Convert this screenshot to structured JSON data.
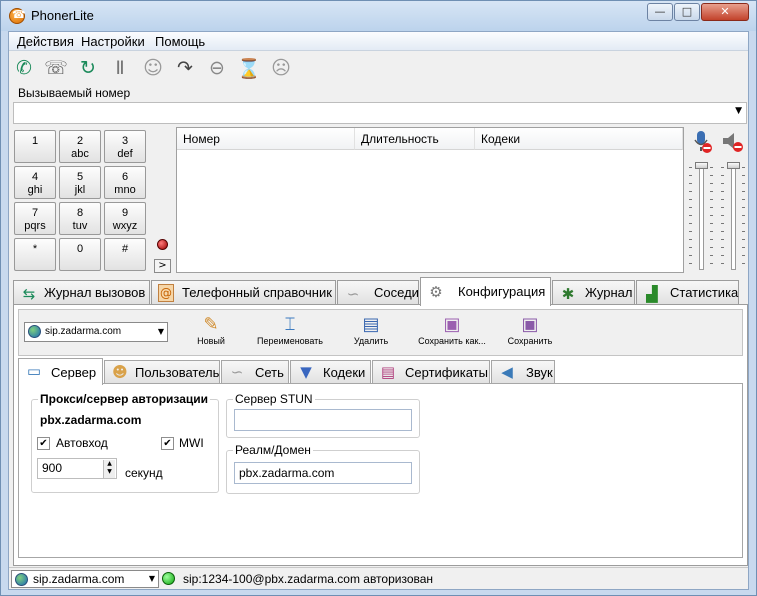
{
  "window": {
    "title": "PhonerLite"
  },
  "menu": [
    "Действия",
    "Настройки",
    "Помощь"
  ],
  "toolbar": [
    "call-icon",
    "hangup-icon",
    "redial-icon",
    "hold-icon",
    "conference-icon",
    "forward-icon",
    "reject-icon",
    "callback-icon",
    "mute-icon"
  ],
  "called": {
    "label": "Вызываемый номер",
    "value": ""
  },
  "keypad": [
    {
      "digit": "1",
      "letters": ""
    },
    {
      "digit": "2",
      "letters": "abc"
    },
    {
      "digit": "3",
      "letters": "def"
    },
    {
      "digit": "4",
      "letters": "ghi"
    },
    {
      "digit": "5",
      "letters": "jkl"
    },
    {
      "digit": "6",
      "letters": "mno"
    },
    {
      "digit": "7",
      "letters": "pqrs"
    },
    {
      "digit": "8",
      "letters": "tuv"
    },
    {
      "digit": "9",
      "letters": "wxyz"
    },
    {
      "digit": "*",
      "letters": ""
    },
    {
      "digit": "0",
      "letters": ""
    },
    {
      "digit": "#",
      "letters": ""
    }
  ],
  "keypad_more": ">",
  "calls_table": {
    "columns": [
      "Номер",
      "Длительность",
      "Кодеки"
    ],
    "rows": []
  },
  "main_tabs": [
    {
      "label": "Журнал вызовов",
      "icon": "call-log-icon"
    },
    {
      "label": "Телефонный справочник",
      "icon": "phonebook-icon"
    },
    {
      "label": "Соседи",
      "icon": "neighbors-icon"
    },
    {
      "label": "Конфигурация",
      "icon": "gear-icon"
    },
    {
      "label": "Журнал",
      "icon": "bug-icon"
    },
    {
      "label": "Статистика",
      "icon": "chart-icon"
    }
  ],
  "config": {
    "account": "sip.zadarma.com",
    "actions": [
      "Новый",
      "Переименовать",
      "Удалить",
      "Сохранить как...",
      "Сохранить"
    ],
    "tabs": [
      "Сервер",
      "Пользователь",
      "Сеть",
      "Кодеки",
      "Сертификаты",
      "Звук"
    ],
    "server": {
      "proxy_label": "Прокси/сервер авторизации",
      "proxy_value": "pbx.zadarma.com",
      "autologin_label": "Автовход",
      "autologin": true,
      "mwi_label": "MWI",
      "mwi": true,
      "interval": "900",
      "interval_unit": "секунд",
      "stun_label": "Сервер STUN",
      "stun_value": "",
      "realm_label": "Реалм/Домен",
      "realm_value": "pbx.zadarma.com"
    }
  },
  "status": {
    "account": "sip.zadarma.com",
    "text": "sip:1234-100@pbx.zadarma.com авторизован"
  }
}
